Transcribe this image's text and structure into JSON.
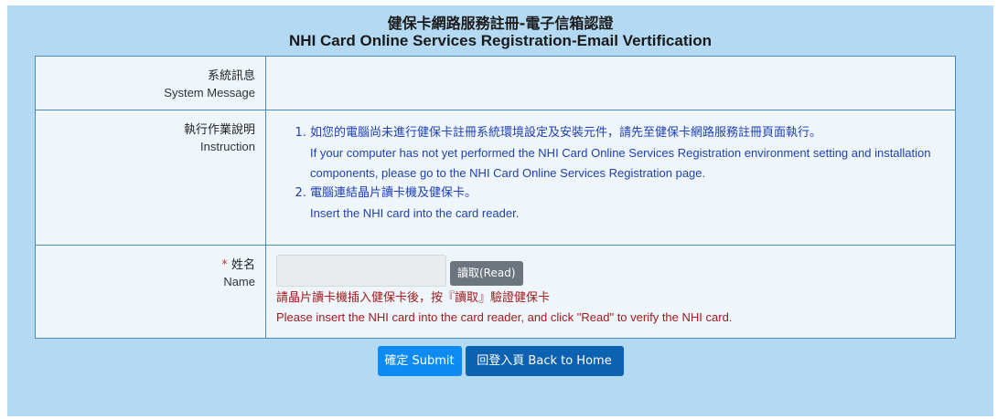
{
  "header": {
    "title_zh": "健保卡網路服務註冊-電子信箱認證",
    "title_en": "NHI Card Online Services Registration-Email Vertification"
  },
  "form": {
    "system_message": {
      "label_zh": "系統訊息",
      "label_en": "System Message",
      "value": ""
    },
    "instruction": {
      "label_zh": "執行作業說明",
      "label_en": "Instruction",
      "items": [
        {
          "zh": "如您的電腦尚未進行健保卡註冊系統環境設定及安裝元件，請先至健保卡網路服務註冊頁面執行。",
          "en": "If your computer has not yet performed the NHI Card Online Services Registration environment setting and installation components, please go to the NHI Card Online Services Registration page."
        },
        {
          "zh": "電腦連結晶片讀卡機及健保卡。",
          "en": "Insert the NHI card into the card reader."
        }
      ]
    },
    "name": {
      "required_mark": "*",
      "label_zh": "姓名",
      "label_en": "Name",
      "input_value": "",
      "read_button": "讀取(Read)",
      "hint_zh": "請晶片讀卡機插入健保卡後，按『讀取』驗證健保卡",
      "hint_en": "Please insert the NHI card into the card reader, and click \"Read\" to verify the NHI card."
    }
  },
  "actions": {
    "submit": "確定 Submit",
    "home": "回登入頁 Back to Home"
  },
  "colors": {
    "panel_bg": "#b4d9f2",
    "table_bg": "#eef6fc",
    "border": "#4a8bb8",
    "instruction_text": "#1f3fb3",
    "warning_text": "#a11b1b",
    "submit_btn": "#0d8bf2",
    "home_btn": "#0c62b0",
    "read_btn": "#6c757d"
  }
}
